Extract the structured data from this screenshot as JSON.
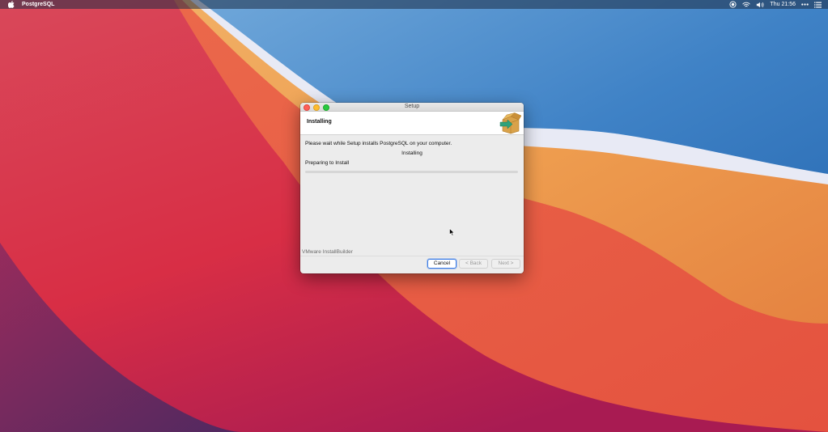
{
  "menubar": {
    "app_name": "PostgreSQL",
    "clock": "Thu 21:56",
    "icons": [
      "apple-icon",
      "screen-record-icon",
      "wifi-icon",
      "volume-icon",
      "more-icon",
      "control-center-icon"
    ]
  },
  "window": {
    "title": "Setup",
    "header_title": "Installing",
    "message": "Please wait while Setup installs PostgreSQL on your computer.",
    "status_center": "Installing",
    "status_left": "Preparing to Install",
    "progress": 0,
    "brand": "VMware InstallBuilder",
    "buttons": {
      "cancel": "Cancel",
      "back": "< Back",
      "next": "Next >"
    }
  },
  "colors": {
    "accent": "#3e7ee6",
    "close": "#fe5f57",
    "minimize": "#febc2e",
    "maximize": "#28c840"
  }
}
